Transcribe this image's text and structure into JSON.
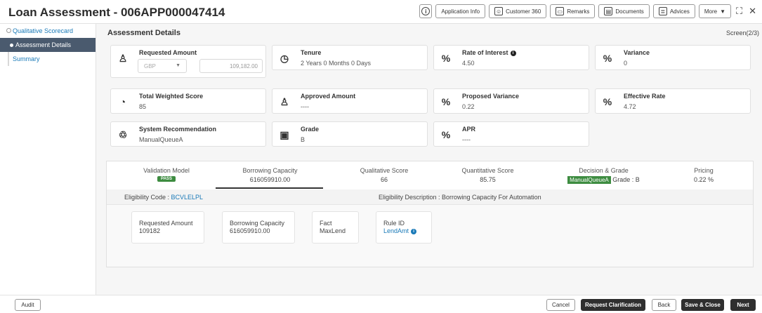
{
  "header": {
    "title": "Loan Assessment - 006APP000047414",
    "buttons": {
      "app_info": "Application Info",
      "customer360": "Customer 360",
      "remarks": "Remarks",
      "documents": "Documents",
      "advices": "Advices",
      "more": "More"
    }
  },
  "sidebar": {
    "items": [
      {
        "label": "Qualitative Scorecard"
      },
      {
        "label": "Assessment Details"
      },
      {
        "label": "Summary"
      }
    ]
  },
  "main": {
    "section_title": "Assessment Details",
    "screen_indicator": "Screen(2/3)",
    "cards": {
      "requested_amount": {
        "label": "Requested Amount",
        "currency": "GBP",
        "amount": "109,182.00"
      },
      "tenure": {
        "label": "Tenure",
        "value": "2 Years 0 Months 0 Days"
      },
      "rate_of_interest": {
        "label": "Rate of Interest",
        "value": "4.50"
      },
      "variance": {
        "label": "Variance",
        "value": "0"
      },
      "total_weighted_score": {
        "label": "Total Weighted Score",
        "value": "85"
      },
      "approved_amount": {
        "label": "Approved Amount",
        "value": "----"
      },
      "proposed_variance": {
        "label": "Proposed Variance",
        "value": "0.22"
      },
      "effective_rate": {
        "label": "Effective Rate",
        "value": "4.72"
      },
      "system_recommendation": {
        "label": "System Recommendation",
        "value": "ManualQueueA"
      },
      "grade": {
        "label": "Grade",
        "value": "B"
      },
      "apr": {
        "label": "APR",
        "value": "----"
      }
    },
    "decision_tabs": [
      {
        "label": "Validation Model",
        "badge": "PASS"
      },
      {
        "label": "Borrowing Capacity",
        "value": "616059910.00"
      },
      {
        "label": "Qualitative Score",
        "value": "66"
      },
      {
        "label": "Quantitative Score",
        "value": "85.75"
      },
      {
        "label": "Decision & Grade",
        "badge": "ManualQueueA",
        "value": "Grade : B"
      },
      {
        "label": "Pricing",
        "value": "0.22 %"
      }
    ],
    "eligibility": {
      "code_label": "Eligibility Code : ",
      "code": "BCVLELPL",
      "description": "Eligibility Description : Borrowing Capacity For Automation"
    },
    "detail_boxes": [
      {
        "label": "Requested Amount",
        "value": "109182"
      },
      {
        "label": "Borrowing Capacity",
        "value": "616059910.00"
      },
      {
        "label": "Fact",
        "value": "MaxLend"
      },
      {
        "label": "Rule ID",
        "value": "LendAmt"
      }
    ]
  },
  "footer": {
    "audit": "Audit",
    "cancel": "Cancel",
    "request_clarification": "Request Clarification",
    "back": "Back",
    "save_close": "Save & Close",
    "next": "Next"
  }
}
